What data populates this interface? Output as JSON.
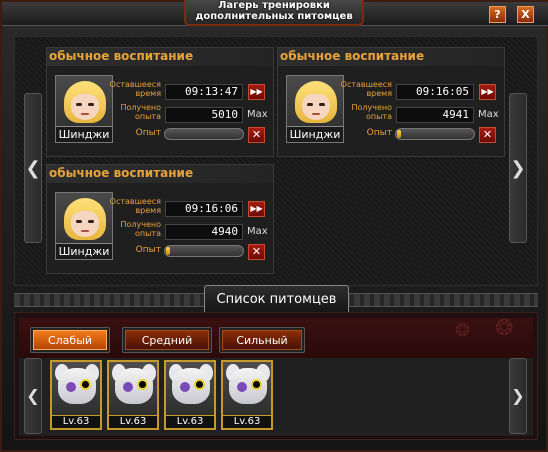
{
  "window": {
    "title_line1": "Лагерь тренировки",
    "title_line2": "дополнительных питомцев",
    "help_label": "?",
    "close_label": "X"
  },
  "labels": {
    "remaining_time": "Оставшееся время",
    "exp_received": "Получено опыта",
    "exp": "Опыт",
    "max": "Max",
    "skip_icon": "▶▶",
    "cancel_icon": "✕"
  },
  "training_slots": [
    {
      "title": "обычное воспитание",
      "pet_name": "Шинджи",
      "time_remaining": "09:13:47",
      "exp_gained": "5010",
      "exp_progress": 0.0
    },
    {
      "title": "обычное воспитание",
      "pet_name": "Шинджи",
      "time_remaining": "09:16:05",
      "exp_gained": "4941",
      "exp_progress": 0.05
    },
    {
      "title": "обычное воспитание",
      "pet_name": "Шинджи",
      "time_remaining": "09:16:06",
      "exp_gained": "4940",
      "exp_progress": 0.05
    }
  ],
  "pet_list": {
    "title": "Список питомцев",
    "tabs": [
      {
        "label": "Слабый",
        "active": true
      },
      {
        "label": "Средний",
        "active": false
      },
      {
        "label": "Сильный",
        "active": false
      }
    ],
    "pets": [
      {
        "level": "Lv.63"
      },
      {
        "level": "Lv.63"
      },
      {
        "level": "Lv.63"
      },
      {
        "level": "Lv.63"
      }
    ]
  },
  "nav": {
    "left": "❮",
    "right": "❯"
  },
  "colors": {
    "accent_orange": "#e8a23a",
    "button_red": "#a51c12",
    "tab_active": "#f07a1a",
    "exp_fill": "#ffd84a"
  }
}
